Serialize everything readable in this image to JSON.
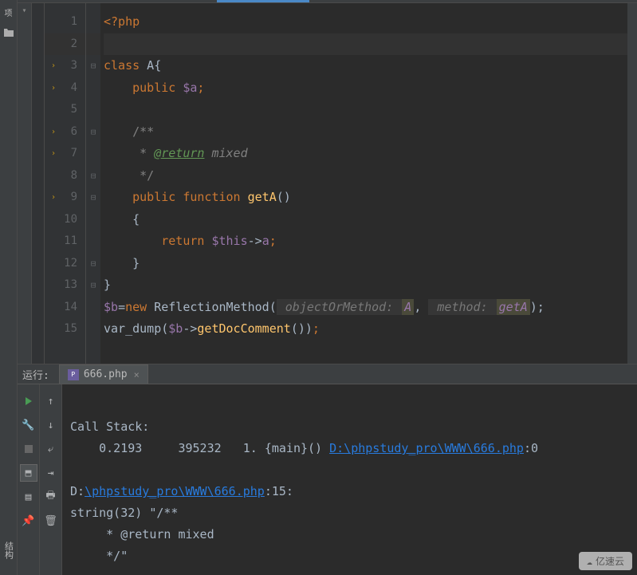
{
  "sidebar": {
    "top_label": "项"
  },
  "side_labels": {
    "structure": "结构"
  },
  "editor": {
    "lines": [
      "1",
      "2",
      "3",
      "4",
      "5",
      "6",
      "7",
      "8",
      "9",
      "10",
      "11",
      "12",
      "13",
      "14",
      "15"
    ],
    "code": {
      "l1_open": "<?php",
      "l3_class": "class",
      "l3_name": " A",
      "l3_brace": "{",
      "l4_vis": "public",
      "l4_var": "$a",
      "l4_semi": ";",
      "l6_doc": "/**",
      "l7_star": " * ",
      "l7_tag": "@return",
      "l7_type": " mixed",
      "l8_end": " */",
      "l9_vis": "public",
      "l9_fn": "function",
      "l9_name": "getA",
      "l9_paren": "()",
      "l10_brace": "{",
      "l11_return": "return",
      "l11_this": "$this",
      "l11_arrow": "->",
      "l11_prop": "a",
      "l11_semi": ";",
      "l12_brace": "}",
      "l13_brace": "}",
      "l14_var": "$b",
      "l14_eq": "=",
      "l14_new": "new",
      "l14_refl": " ReflectionMethod(",
      "l14_hint1": " objectOrMethod: ",
      "l14_val1": "A",
      "l14_comma": ", ",
      "l14_hint2": " method: ",
      "l14_val2": "getA",
      "l14_close": ");",
      "l15_dump": "var_dump(",
      "l15_var": "$b",
      "l15_arrow": "->",
      "l15_method": "getDocComment",
      "l15_paren": "())",
      "l15_semi": ";"
    }
  },
  "run": {
    "label": "运行:",
    "tab_name": "666.php",
    "output": {
      "call_stack": "Call Stack:",
      "line2_pre": "    0.2193     395232   1. {main}() ",
      "line2_link": "D:\\phpstudy_pro\\WWW\\666.php",
      "line2_post": ":0",
      "line4_pre": "D:",
      "line4_link": "\\phpstudy_pro\\WWW\\666.php",
      "line4_post": ":15:",
      "line5": "string(32) \"/**",
      "line6": "     * @return mixed",
      "line7": "     */\""
    }
  },
  "watermark": {
    "text": "亿速云"
  }
}
